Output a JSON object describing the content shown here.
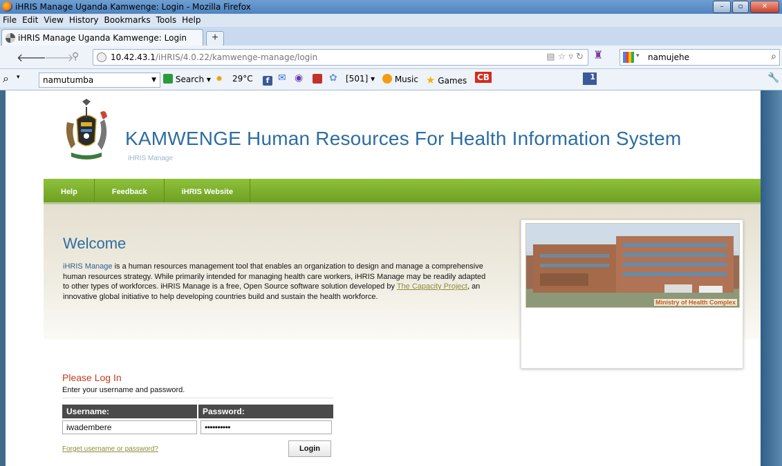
{
  "window": {
    "title": "iHRIS Manage Uganda Kamwenge: Login - Mozilla Firefox"
  },
  "menubar": {
    "items": [
      "File",
      "Edit",
      "View",
      "History",
      "Bookmarks",
      "Tools",
      "Help"
    ]
  },
  "tab": {
    "title": "iHRIS Manage Uganda Kamwenge: Login",
    "new_tab": "+"
  },
  "address_bar": {
    "host": "10.42.43.1",
    "path": "/iHRIS/4.0.22/kamwenge-manage/login"
  },
  "search_bar": {
    "query": "namujehe"
  },
  "toolbar2": {
    "combo_value": "namutumba",
    "search_label": "Search",
    "temperature": "29°C",
    "count_badge": "[501]",
    "music_label": "Music",
    "games_label": "Games",
    "cb_label": "CB",
    "fb_badge": "1"
  },
  "header": {
    "system_title": "KAMWENGE Human Resources For Health Information System",
    "subtitle": "iHRIS Manage"
  },
  "nav": {
    "items": [
      "Help",
      "Feedback",
      "iHRIS Website"
    ]
  },
  "welcome": {
    "heading": "Welcome",
    "brand": "iHRIS Manage",
    "para_1": " is a human resources management tool that enables an organization to design and manage a comprehensive human resources strategy. While primarily intended for managing health care workers, iHRIS Manage may be readily adapted to other types of workforces. iHRIS Manage is a free, Open Source software solution developed by ",
    "link": "The Capacity Project",
    "para_2": ", an innovative global initiative to help developing countries build and sustain the health workforce."
  },
  "photo": {
    "caption": "Ministry of Health Complex"
  },
  "login": {
    "heading": "Please Log In",
    "instructions": "Enter your username and password.",
    "username_label": "Username:",
    "password_label": "Password:",
    "username_value": "iwadembere",
    "password_masked": "••••••••••",
    "forgot_link": "Forget username or password?",
    "button": "Login"
  },
  "colors": {
    "accent_blue": "#2d6da0",
    "nav_green": "#7fb12f",
    "login_red": "#c13a1a"
  }
}
